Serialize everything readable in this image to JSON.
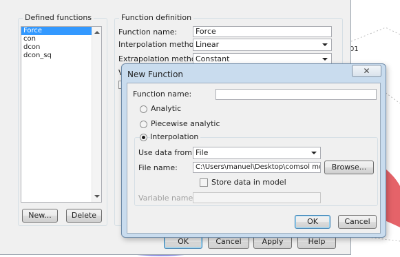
{
  "plot": {
    "axis_tick_label": "01"
  },
  "main_dialog": {
    "defined_functions_title": "Defined functions",
    "functions": [
      {
        "label": "Force",
        "selected": true
      },
      {
        "label": "con",
        "selected": false
      },
      {
        "label": "dcon",
        "selected": false
      },
      {
        "label": "dcon_sq",
        "selected": false
      }
    ],
    "new_label": "New...",
    "delete_label": "Delete",
    "definition_title": "Function definition",
    "function_name_label": "Function name:",
    "function_name_value": "Force",
    "interpolation_label": "Interpolation method:",
    "interpolation_value": "Linear",
    "extrapolation_label": "Extrapolation method:",
    "extrapolation_value": "Constant",
    "truncated_label": "V",
    "ok_label": "OK",
    "cancel_label": "Cancel",
    "apply_label": "Apply",
    "help_label": "Help"
  },
  "new_function": {
    "title": "New Function",
    "close_glyph": "✕",
    "function_name_label": "Function name:",
    "function_name_value": "",
    "options": [
      {
        "label": "Analytic",
        "checked": false
      },
      {
        "label": "Piecewise analytic",
        "checked": false
      },
      {
        "label": "Interpolation",
        "checked": true
      }
    ],
    "use_data_from_label": "Use data from:",
    "use_data_from_value": "File",
    "file_name_label": "File name:",
    "file_name_value": "C:\\Users\\manuel\\Desktop\\comsol mod",
    "browse_label": "Browse...",
    "store_data_label": "Store data in model",
    "variable_name_label": "Variable name:",
    "variable_name_value": "",
    "ok_label": "OK",
    "cancel_label": "Cancel"
  },
  "colors": {
    "selection": "#3399ff",
    "dialog_frame": "#c9dcee",
    "plot_red": "#e0484f",
    "plot_blue": "#3a3ad0"
  }
}
